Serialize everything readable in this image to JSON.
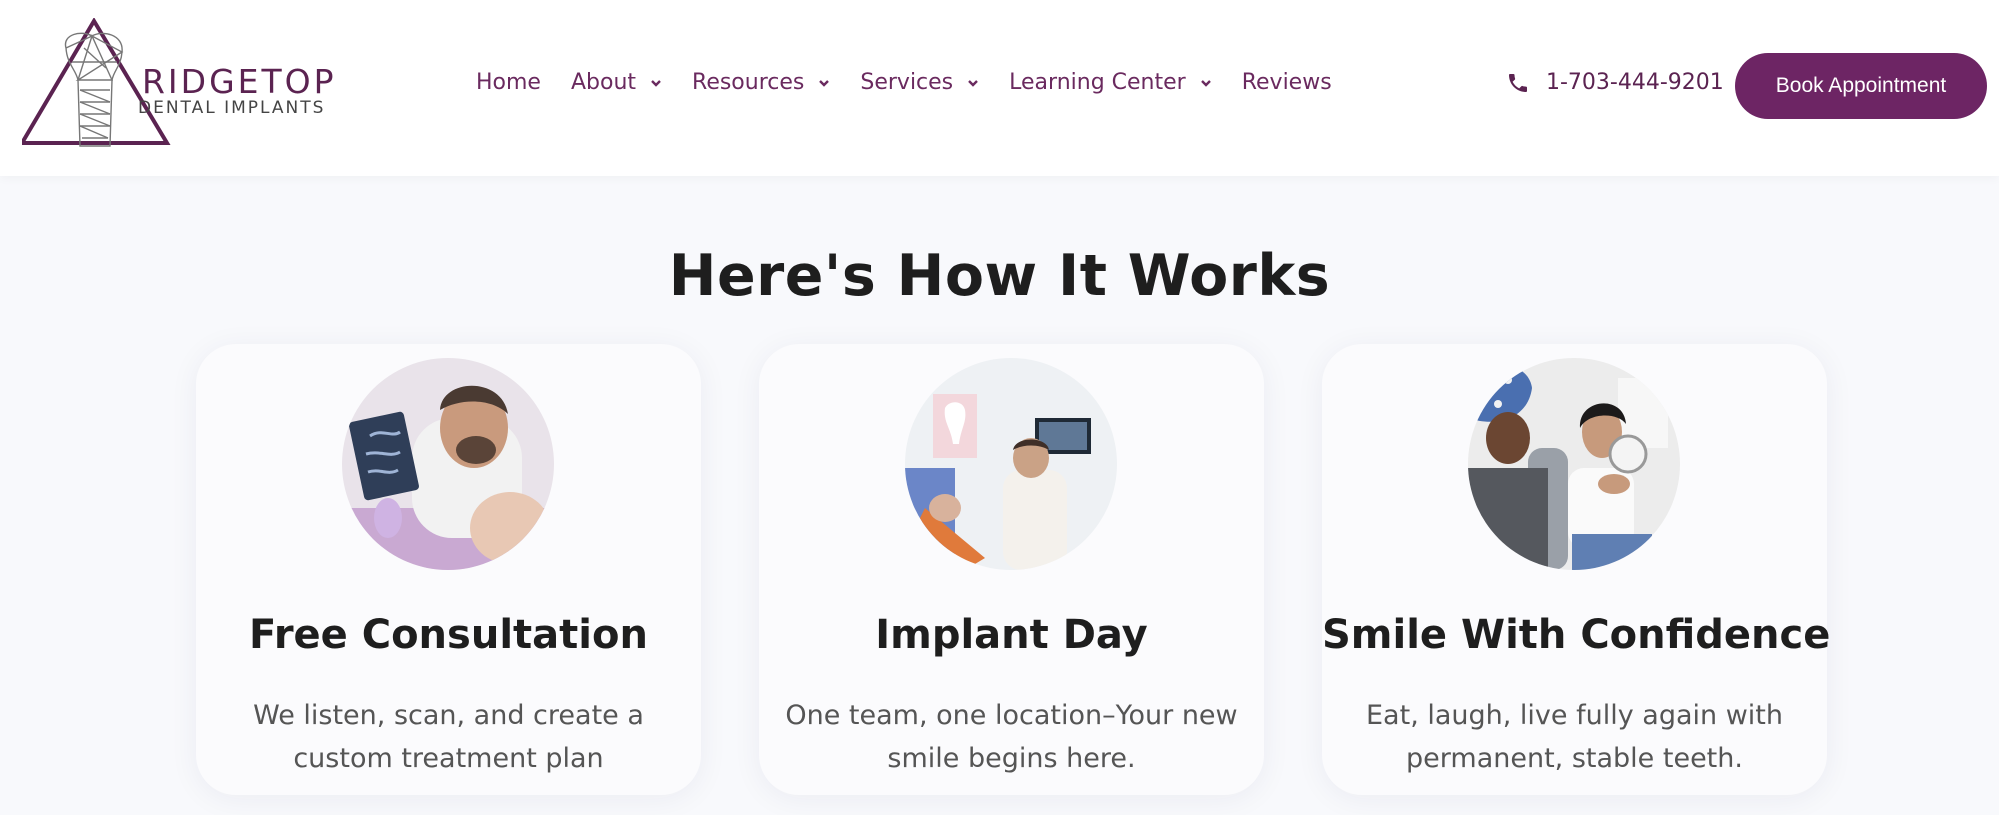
{
  "header": {
    "logo": {
      "title": "RIDGETOP",
      "subtitle": "DENTAL IMPLANTS",
      "icon": "tooth-triangle-logo-icon"
    },
    "nav": [
      {
        "label": "Home",
        "has_dropdown": false
      },
      {
        "label": "About",
        "has_dropdown": true
      },
      {
        "label": "Resources",
        "has_dropdown": true
      },
      {
        "label": "Services",
        "has_dropdown": true
      },
      {
        "label": "Learning Center",
        "has_dropdown": true
      },
      {
        "label": "Reviews",
        "has_dropdown": false
      }
    ],
    "phone": {
      "number": "1-703-444-9201",
      "icon": "phone-icon"
    },
    "cta": {
      "label": "Book Appointment"
    }
  },
  "section": {
    "title": "Here's How It Works",
    "cards": [
      {
        "title": "Free Consultation",
        "text": "We listen, scan, and create a custom treatment plan",
        "image": "dentist-xray-photo"
      },
      {
        "title": "Implant Day",
        "text": "One team, one location–Your new smile begins here.",
        "image": "dental-office-procedure-photo"
      },
      {
        "title": "Smile With Confidence",
        "text": "Eat, laugh, live fully again with permanent, stable teeth.",
        "image": "smiling-patient-mirror-photo"
      }
    ]
  },
  "colors": {
    "brand": "#6d2564",
    "nav_text": "#6a2a5f",
    "background": "#f8f9fc",
    "card": "#fbfbfd"
  }
}
